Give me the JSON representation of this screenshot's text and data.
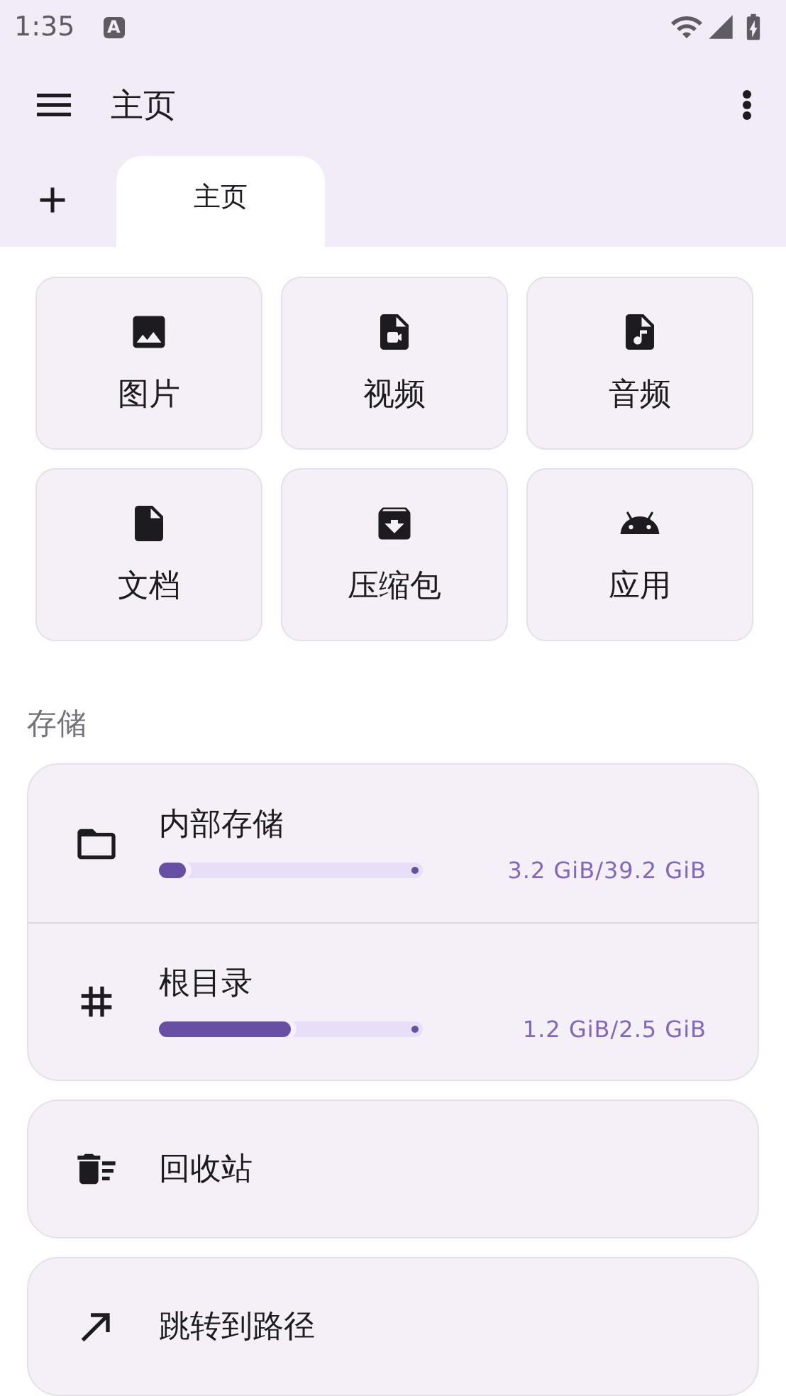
{
  "status_bar": {
    "time": "1:35",
    "input_indicator": "A"
  },
  "app_bar": {
    "title": "主页"
  },
  "tabs": [
    {
      "label": "主页",
      "selected": true
    }
  ],
  "categories": [
    {
      "label": "图片"
    },
    {
      "label": "视频"
    },
    {
      "label": "音频"
    },
    {
      "label": "文档"
    },
    {
      "label": "压缩包"
    },
    {
      "label": "应用"
    }
  ],
  "storage": {
    "heading": "存储",
    "items": [
      {
        "name": "内部存储",
        "level": 0.1,
        "reading": "3.2 GiB/39.2 GiB"
      },
      {
        "name": "根目录",
        "level": 0.5,
        "reading": "1.2 GiB/2.5 GiB"
      }
    ]
  },
  "actions": [
    {
      "label": "回收站"
    },
    {
      "label": "跳转到路径"
    }
  ]
}
